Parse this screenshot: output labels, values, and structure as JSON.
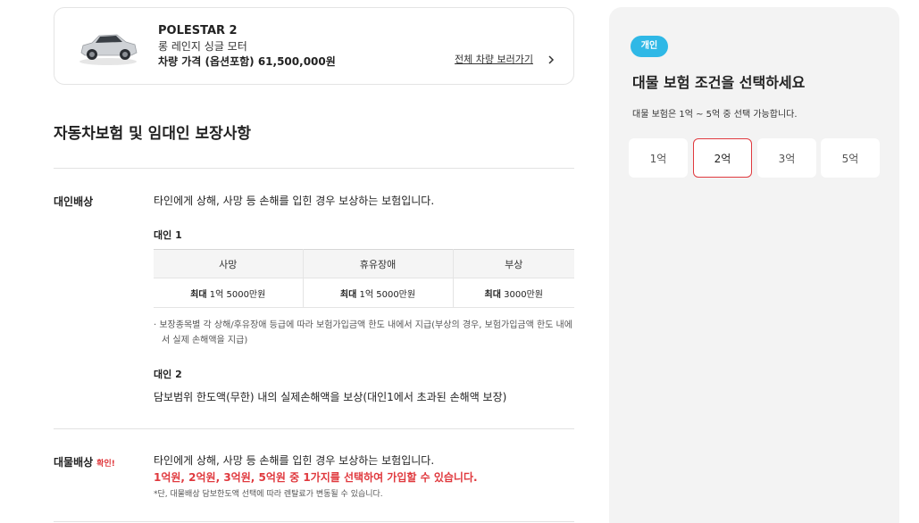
{
  "car": {
    "name": "POLESTAR 2",
    "trim": "롱 레인지 싱글 모터",
    "price": "차량 가격 (옵션포함) 61,500,000원",
    "all_cars_link": "전체 차량 보러가기"
  },
  "section": {
    "title": "자동차보험 및 임대인 보장사항"
  },
  "bodily": {
    "label": "대인배상",
    "desc": "타인에게 상해, 사망 등 손해를 입힌 경우 보상하는 보험입니다.",
    "sub1_title": "대인 1",
    "table": {
      "headers": [
        "사망",
        "휴유장애",
        "부상"
      ],
      "cells": [
        {
          "bold": "최대",
          "rest": " 1억 5000만원"
        },
        {
          "bold": "최대",
          "rest": " 1억 5000만원"
        },
        {
          "bold": "최대",
          "rest": " 3000만원"
        }
      ]
    },
    "note": "· 보장종목별 각 상해/후유장애 등급에 따라 보험가입금액 한도 내에서 지급(부상의 경우, 보험가입금액 한도 내에서 실제 손해액을 지급)",
    "sub2_title": "대인 2",
    "sub2_desc": "담보범위 한도액(무한) 내의 실제손해액을 보상(대인1에서 초과된 손해액 보장)"
  },
  "property": {
    "label": "대물배상",
    "confirm": "확인!",
    "desc": "타인에게 상해, 사망 등 손해를 입힌 경우 보상하는 보험입니다.",
    "highlight": "1억원, 2억원, 3억원, 5억원 중 1가지를 선택하여 가입할 수 있습니다.",
    "small_note": "*단, 대물배상 담보한도액 선택에 따라 렌탈료가 변동될 수 있습니다."
  },
  "panel": {
    "badge": "개인",
    "title": "대물 보험 조건을 선택하세요",
    "subtitle": "대물 보험은 1억 ~ 5억 중 선택 가능합니다.",
    "options": [
      "1억",
      "2억",
      "3억",
      "5억"
    ],
    "selected_index": 1,
    "badge_color": "#2fb8e6",
    "accent_color": "#e0393e"
  }
}
